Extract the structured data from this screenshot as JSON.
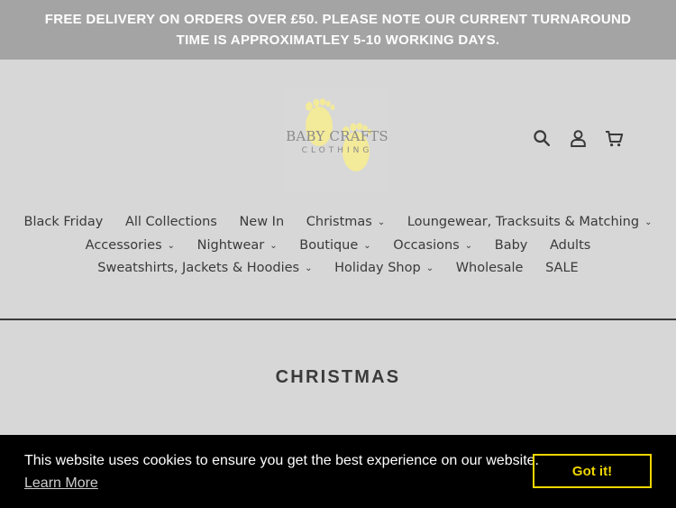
{
  "announcement": {
    "line1": "FREE DELIVERY ON ORDERS OVER £50. PLEASE NOTE OUR CURRENT TURNAROUND",
    "line2": "TIME IS APPROXIMATLEY 5-10 WORKING DAYS."
  },
  "logo": {
    "title": "BABY CRAFTS",
    "subtitle": "CLOTHING",
    "feet_color": "#f3ea9a"
  },
  "header_icons": [
    "search-icon",
    "account-icon",
    "cart-icon"
  ],
  "nav": {
    "row1": [
      {
        "label": "Black Friday",
        "dropdown": false
      },
      {
        "label": "All Collections",
        "dropdown": false
      },
      {
        "label": "New In",
        "dropdown": false
      },
      {
        "label": "Christmas",
        "dropdown": true
      },
      {
        "label": "Loungewear, Tracksuits & Matching",
        "dropdown": true
      }
    ],
    "row2": [
      {
        "label": "Accessories",
        "dropdown": true
      },
      {
        "label": "Nightwear",
        "dropdown": true
      },
      {
        "label": "Boutique",
        "dropdown": true
      },
      {
        "label": "Occasions",
        "dropdown": true
      },
      {
        "label": "Baby",
        "dropdown": false
      },
      {
        "label": "Adults",
        "dropdown": false
      }
    ],
    "row3": [
      {
        "label": "Sweatshirts, Jackets & Hoodies",
        "dropdown": true
      },
      {
        "label": "Holiday Shop",
        "dropdown": true
      },
      {
        "label": "Wholesale",
        "dropdown": false
      },
      {
        "label": "SALE",
        "dropdown": false
      }
    ]
  },
  "collection": {
    "title": "CHRISTMAS"
  },
  "cookie": {
    "message": "This website uses cookies to ensure you get the best experience on our website.",
    "learn_more": "Learn More",
    "accept_label": "Got it!",
    "accent_color": "#f1d600"
  }
}
